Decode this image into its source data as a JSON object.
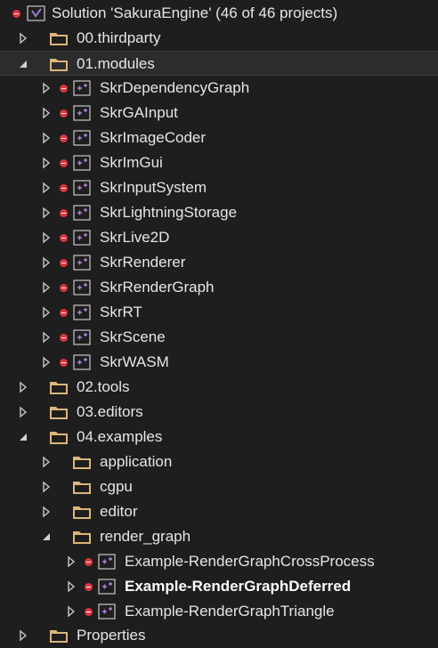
{
  "solution": {
    "label": "Solution 'SakuraEngine' (46 of 46 projects)"
  },
  "tree": [
    {
      "label": "00.thirdparty"
    },
    {
      "label": "01.modules"
    },
    {
      "label": "SkrDependencyGraph"
    },
    {
      "label": "SkrGAInput"
    },
    {
      "label": "SkrImageCoder"
    },
    {
      "label": "SkrImGui"
    },
    {
      "label": "SkrInputSystem"
    },
    {
      "label": "SkrLightningStorage"
    },
    {
      "label": "SkrLive2D"
    },
    {
      "label": "SkrRenderer"
    },
    {
      "label": "SkrRenderGraph"
    },
    {
      "label": "SkrRT"
    },
    {
      "label": "SkrScene"
    },
    {
      "label": "SkrWASM"
    },
    {
      "label": "02.tools"
    },
    {
      "label": "03.editors"
    },
    {
      "label": "04.examples"
    },
    {
      "label": "application"
    },
    {
      "label": "cgpu"
    },
    {
      "label": "editor"
    },
    {
      "label": "render_graph"
    },
    {
      "label": "Example-RenderGraphCrossProcess"
    },
    {
      "label": "Example-RenderGraphDeferred"
    },
    {
      "label": "Example-RenderGraphTriangle"
    },
    {
      "label": "Properties"
    }
  ],
  "colors": {
    "background": "#1e1e1e",
    "folder": "#dcb67a",
    "error": "#e0343e",
    "project": "#b180d7",
    "vs_logo": "#9b7bd6"
  }
}
